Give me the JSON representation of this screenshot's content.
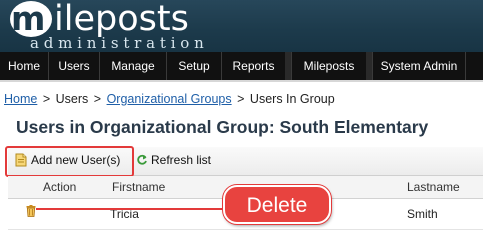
{
  "header": {
    "logo_first_letter": "m",
    "logo_rest": "ileposts",
    "logo_subtitle": "administration"
  },
  "nav": {
    "items": [
      "Home",
      "Users",
      "Manage",
      "Setup",
      "Reports",
      "Mileposts",
      "System Admin"
    ]
  },
  "breadcrumb": {
    "home": "Home",
    "users": "Users",
    "org_groups": "Organizational Groups",
    "current": "Users In Group",
    "separator": ">"
  },
  "page": {
    "title": "Users in Organizational Group: South Elementary"
  },
  "toolbar": {
    "add_label": "Add new User(s)",
    "refresh_label": "Refresh list"
  },
  "table": {
    "headers": [
      "Action",
      "Firstname",
      "Lastname"
    ],
    "rows": [
      {
        "firstname": "Tricia",
        "lastname": "Smith"
      }
    ]
  },
  "annotation": {
    "callout_text": "Delete",
    "accent_color": "#e33a3a"
  }
}
